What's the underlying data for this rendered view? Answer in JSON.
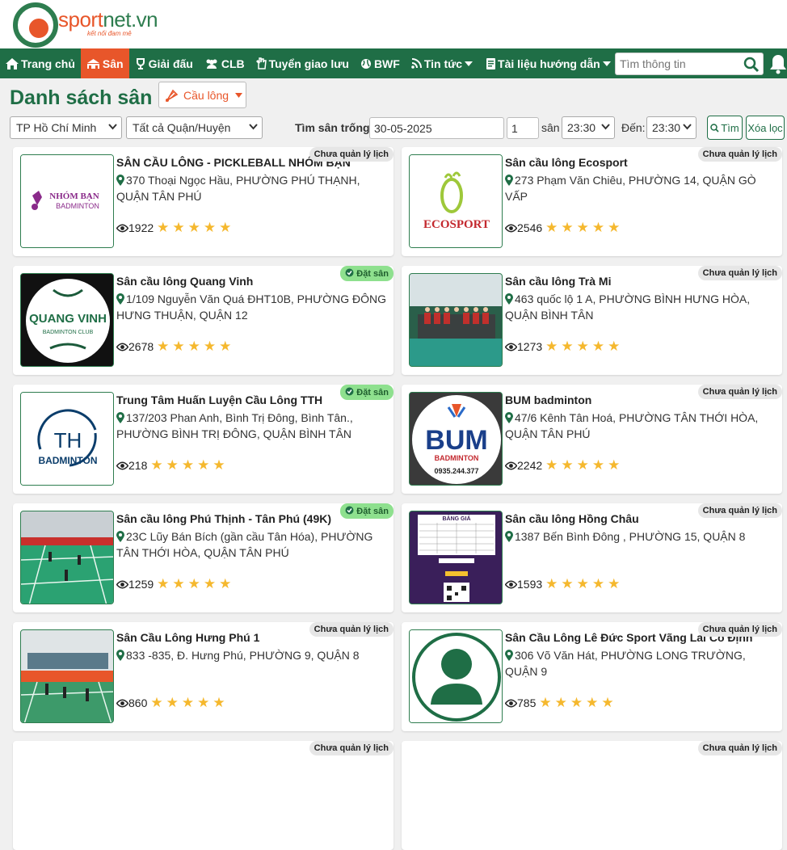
{
  "brand": {
    "name_part1": "sport",
    "name_part2": "net.vn",
    "tagline": "kết nối đam mê"
  },
  "nav": {
    "items": [
      {
        "label": "Trang chủ",
        "icon": "home-icon"
      },
      {
        "label": "Sân",
        "icon": "court-icon",
        "active": true
      },
      {
        "label": "Giải đấu",
        "icon": "trophy-icon"
      },
      {
        "label": "CLB",
        "icon": "group-icon"
      },
      {
        "label": "Tuyển giao lưu",
        "icon": "hand-icon"
      },
      {
        "label": "BWF",
        "icon": "globe-icon"
      },
      {
        "label": "Tin tức",
        "icon": "rss-icon",
        "dropdown": true
      },
      {
        "label": "Tài liệu hướng dẫn",
        "icon": "document-icon",
        "dropdown": true
      }
    ],
    "search_placeholder": "Tìm thông tin"
  },
  "page": {
    "title": "Danh sách sân",
    "sport": "Cầu lông"
  },
  "filters": {
    "city": "TP Hồ Chí Minh",
    "district": "Tất cả Quận/Huyện",
    "search_label": "Tìm sân trống:",
    "date": "30-05-2025",
    "count": "1",
    "count_unit": "sân",
    "from_time": "23:30",
    "to_label": "Đến:",
    "to_time": "23:30",
    "search_button": "Tìm",
    "clear_button": "Xóa lọc"
  },
  "colors": {
    "primary": "#1f6e46",
    "accent": "#e8562a",
    "star": "#f5b82e",
    "book_badge": "#8ee08e"
  },
  "courts": [
    {
      "name": "SÂN CẦU LÔNG - PICKLEBALL NHÓM BẠN",
      "address": "370 Thoại Ngọc Hầu, PHƯỜNG PHÚ THẠNH, QUẬN TÂN PHÚ",
      "views": "1922",
      "badge": "Chưa quản lý lịch",
      "logo_text": "NHÓM BẠN",
      "logo_sub": "BADMINTON"
    },
    {
      "name": "Sân cầu lông Ecosport",
      "address": "273 Phạm Văn Chiêu, PHƯỜNG 14, QUẬN GÒ VẤP",
      "views": "2546",
      "badge": "Chưa quản lý lịch",
      "logo_text": "ECOSPORT"
    },
    {
      "name": "Sân cầu lông Quang Vinh",
      "address": "1/109 Nguyễn Văn Quá ĐHT10B, PHƯỜNG ĐÔNG HƯNG THUẬN, QUẬN 12",
      "views": "2678",
      "badge": "Đặt sân",
      "logo_text": "QUANG VINH",
      "logo_sub": "BADMINTON CLUB"
    },
    {
      "name": "Sân cầu lông Trà Mi",
      "address": "463 quốc lộ 1 A, PHƯỜNG BÌNH HƯNG HÒA, QUẬN BÌNH TÂN",
      "views": "1273",
      "badge": "Chưa quản lý lịch"
    },
    {
      "name": "Trung Tâm Huấn Luyện Cầu Lông TTH",
      "address": "137/203 Phan Anh, Bình Trị Đông, Bình Tân., PHƯỜNG BÌNH TRỊ ĐÔNG, QUẬN BÌNH TÂN",
      "views": "218",
      "badge": "Đặt sân",
      "logo_text": "TH",
      "logo_sub": "BADMINTON"
    },
    {
      "name": "BUM badminton",
      "address": "47/6 Kênh Tân Hoá, PHƯỜNG TÂN THỚI HÒA, QUẬN TÂN PHÚ",
      "views": "2242",
      "badge": "Chưa quản lý lịch",
      "logo_text": "BUM",
      "logo_sub": "BADMINTON",
      "logo_phone": "0935.244.377"
    },
    {
      "name": "Sân cầu lông Phú Thịnh - Tân Phú (49K)",
      "address": "23C Lũy Bán Bích (gần cầu Tân Hóa), PHƯỜNG TÂN THỚI HÒA, QUẬN TÂN PHÚ",
      "views": "1259",
      "badge": "Đặt sân"
    },
    {
      "name": "Sân cầu lông Hồng Châu",
      "address": "1387 Bến Bình Đông , PHƯỜNG 15, QUẬN 8",
      "views": "1593",
      "badge": "Chưa quản lý lịch",
      "logo_text": "BẢNG GIÁ"
    },
    {
      "name": "Sân Cầu Lông Hưng Phú 1",
      "address": "833 -835, Đ. Hưng Phú, PHƯỜNG 9, QUẬN 8",
      "views": "860",
      "badge": "Chưa quản lý lịch"
    },
    {
      "name": "Sân Cầu Lông Lê Đức Sport Vãng Lai Cố Định",
      "address": "306 Võ Văn Hát, PHƯỜNG LONG TRƯỜNG, QUẬN 9",
      "views": "785",
      "badge": "Chưa quản lý lịch"
    }
  ],
  "partial_badges": [
    "Chưa quản lý lịch",
    "Chưa quản lý lịch"
  ]
}
